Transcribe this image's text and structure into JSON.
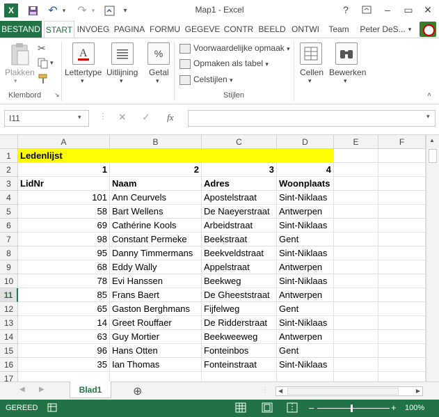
{
  "window": {
    "title": "Map1 - Excel",
    "help": "?",
    "minimize": "–",
    "restore": "▭",
    "close": "✕"
  },
  "qat": {
    "logo": "X",
    "save_icon": "💾",
    "undo_icon": "↶",
    "redo_icon": "↷",
    "customize_icon": "▾"
  },
  "tabs": [
    {
      "label": "BESTAND"
    },
    {
      "label": "START"
    },
    {
      "label": "INVOEG"
    },
    {
      "label": "PAGINA"
    },
    {
      "label": "FORMU"
    },
    {
      "label": "GEGEVE"
    },
    {
      "label": "CONTR"
    },
    {
      "label": "BEELD"
    },
    {
      "label": "ONTWI"
    },
    {
      "label": "Team"
    }
  ],
  "user": {
    "name": "Peter DeS..."
  },
  "ribbon": {
    "paste_label": "Plakken",
    "clipboard_group": "Klembord",
    "font_label": "Lettertype",
    "alignment_label": "Uitlijning",
    "number_label": "Getal",
    "number_symbol": "%",
    "conditional_label": "Voorwaardelijke opmaak",
    "format_table_label": "Opmaken als tabel",
    "cell_styles_label": "Celstijlen",
    "styles_group": "Stijlen",
    "cells_label": "Cellen",
    "edit_label": "Bewerken"
  },
  "formula_bar": {
    "namebox_value": "I11",
    "cancel": "✕",
    "enter": "✓",
    "fx": "fx",
    "formula_value": ""
  },
  "columns": [
    "A",
    "B",
    "C",
    "D",
    "E",
    "F"
  ],
  "rows": [
    {
      "n": "1",
      "a": "Ledenlijst",
      "b": "",
      "c": "",
      "d": ""
    },
    {
      "n": "2",
      "a": "1",
      "b": "2",
      "c": "3",
      "d": "4"
    },
    {
      "n": "3",
      "a": "LidNr",
      "b": "Naam",
      "c": "Adres",
      "d": "Woonplaats"
    },
    {
      "n": "4",
      "a": "101",
      "b": "Ann Ceurvels",
      "c": "Apostelstraat",
      "d": "Sint-Niklaas"
    },
    {
      "n": "5",
      "a": "58",
      "b": "Bart Wellens",
      "c": "De Naeyerstraat",
      "d": "Antwerpen"
    },
    {
      "n": "6",
      "a": "69",
      "b": "Cathérine Kools",
      "c": "Arbeidstraat",
      "d": "Sint-Niklaas"
    },
    {
      "n": "7",
      "a": "98",
      "b": "Constant Permeke",
      "c": "Beekstraat",
      "d": "Gent"
    },
    {
      "n": "8",
      "a": "95",
      "b": "Danny Timmermans",
      "c": "Beekveldstraat",
      "d": "Sint-Niklaas"
    },
    {
      "n": "9",
      "a": "68",
      "b": "Eddy Wally",
      "c": "Appelstraat",
      "d": "Antwerpen"
    },
    {
      "n": "10",
      "a": "78",
      "b": "Evi Hanssen",
      "c": "Beekweg",
      "d": "Sint-Niklaas"
    },
    {
      "n": "11",
      "a": "85",
      "b": "Frans Baert",
      "c": "De Gheeststraat",
      "d": "Antwerpen"
    },
    {
      "n": "12",
      "a": "65",
      "b": "Gaston Berghmans",
      "c": "Fijfelweg",
      "d": "Gent"
    },
    {
      "n": "13",
      "a": "14",
      "b": "Greet Rouffaer",
      "c": "De Ridderstraat",
      "d": "Sint-Niklaas"
    },
    {
      "n": "14",
      "a": "63",
      "b": "Guy Mortier",
      "c": "Beekweeweg",
      "d": "Antwerpen"
    },
    {
      "n": "15",
      "a": "96",
      "b": "Hans Otten",
      "c": "Fonteinbos",
      "d": "Gent"
    },
    {
      "n": "16",
      "a": "35",
      "b": "Ian Thomas",
      "c": "Fonteinstraat",
      "d": "Sint-Niklaas"
    },
    {
      "n": "17",
      "a": "",
      "b": "",
      "c": "",
      "d": ""
    }
  ],
  "sheet_tabs": {
    "active": "Blad1",
    "add": "⊕"
  },
  "status": {
    "ready": "GEREED",
    "zoom": "100%",
    "zoom_minus": "–",
    "zoom_plus": "+"
  },
  "colors": {
    "accent": "#217346",
    "title_highlight": "#ffff00"
  }
}
